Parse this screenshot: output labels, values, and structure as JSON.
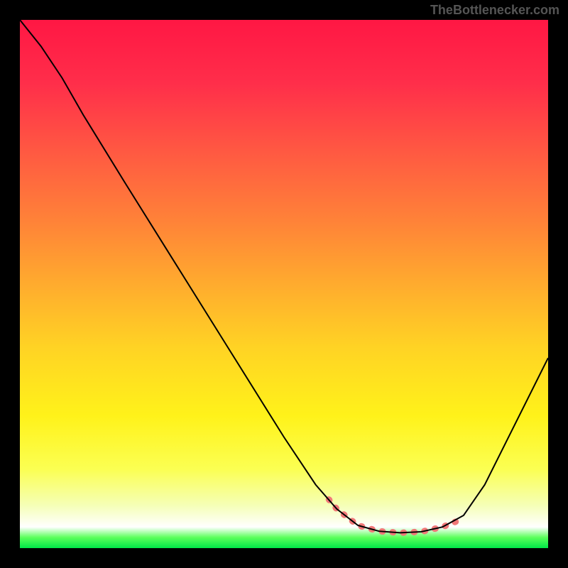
{
  "watermark": "TheBottlenecker.com",
  "chart_data": {
    "type": "line",
    "title": "",
    "xlabel": "",
    "ylabel": "",
    "x_range": [
      0,
      100
    ],
    "y_range": [
      0,
      100
    ],
    "gradient_stops": [
      {
        "offset": 0,
        "color": "#ff1744"
      },
      {
        "offset": 12,
        "color": "#ff2e4a"
      },
      {
        "offset": 25,
        "color": "#ff5942"
      },
      {
        "offset": 38,
        "color": "#ff8238"
      },
      {
        "offset": 50,
        "color": "#ffab2e"
      },
      {
        "offset": 62,
        "color": "#ffd324"
      },
      {
        "offset": 75,
        "color": "#fff21a"
      },
      {
        "offset": 85,
        "color": "#fbff52"
      },
      {
        "offset": 92,
        "color": "#f5ffb8"
      },
      {
        "offset": 96,
        "color": "#ffffff"
      },
      {
        "offset": 98,
        "color": "#5aff5a"
      },
      {
        "offset": 100,
        "color": "#00e648"
      }
    ],
    "series": [
      {
        "name": "main-curve",
        "color": "#000000",
        "stroke_width": 2,
        "points": [
          {
            "x": 0,
            "y": 100
          },
          {
            "x": 4,
            "y": 95
          },
          {
            "x": 8,
            "y": 89
          },
          {
            "x": 12,
            "y": 82
          },
          {
            "x": 20,
            "y": 69
          },
          {
            "x": 30,
            "y": 53
          },
          {
            "x": 40,
            "y": 37
          },
          {
            "x": 50,
            "y": 21
          },
          {
            "x": 56,
            "y": 12
          },
          {
            "x": 60,
            "y": 7.4
          },
          {
            "x": 64,
            "y": 4.3
          },
          {
            "x": 68,
            "y": 3.2
          },
          {
            "x": 72,
            "y": 2.9
          },
          {
            "x": 76,
            "y": 3.1
          },
          {
            "x": 80,
            "y": 4.0
          },
          {
            "x": 84,
            "y": 6.2
          },
          {
            "x": 88,
            "y": 12
          },
          {
            "x": 92,
            "y": 20
          },
          {
            "x": 96,
            "y": 28
          },
          {
            "x": 100,
            "y": 36
          }
        ]
      },
      {
        "name": "highlight-segment",
        "color": "#f07878",
        "stroke_width": 9,
        "round_caps": true,
        "points": [
          {
            "x": 58.5,
            "y": 9.2
          },
          {
            "x": 60,
            "y": 7.4
          },
          {
            "x": 64,
            "y": 4.3
          },
          {
            "x": 68,
            "y": 3.2
          },
          {
            "x": 72,
            "y": 2.9
          },
          {
            "x": 76,
            "y": 3.1
          },
          {
            "x": 80,
            "y": 4.0
          },
          {
            "x": 82.5,
            "y": 5.0
          }
        ]
      }
    ]
  }
}
